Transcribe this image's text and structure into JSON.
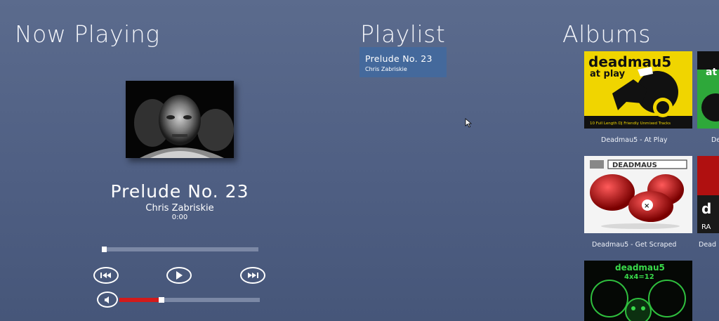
{
  "sections": {
    "now_playing_title": "Now Playing",
    "playlist_title": "Playlist",
    "albums_title": "Albums"
  },
  "now_playing": {
    "track_title": "Prelude No. 23",
    "artist": "Chris Zabriskie",
    "time": "0:00",
    "seek_progress": 0.0,
    "volume_level": 0.3
  },
  "controls": {
    "previous_icon": "skip-previous-icon",
    "play_icon": "play-icon",
    "next_icon": "skip-next-icon",
    "volume_icon": "volume-icon"
  },
  "playlist": {
    "items": [
      {
        "title": "Prelude No. 23",
        "artist": "Chris Zabriskie"
      }
    ]
  },
  "albums": {
    "items": [
      {
        "name": "Deadmau5 - At Play",
        "cover_text": "deadmau5",
        "cover_sub": "at play",
        "cover_caption": "10 Full Length DJ Friendly Unmixed Tracks"
      },
      {
        "name": "De",
        "cover_text": "at"
      },
      {
        "name": "Deadmau5 - Get Scraped",
        "cover_text": "DEADMAUS"
      },
      {
        "name": "Dead",
        "cover_text": "d",
        "cover_sub": "RA"
      },
      {
        "name": "",
        "cover_text": "deadmau5",
        "cover_sub": "4x4=12"
      }
    ]
  },
  "colors": {
    "background": "#55658a",
    "playlist_highlight": "#44699c",
    "volume_fill": "#d21b1b",
    "track_bar": "#7b88a5"
  }
}
